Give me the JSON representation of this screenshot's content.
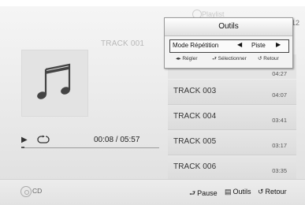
{
  "header": {
    "playlist_label": "Playlist",
    "track_count": "12"
  },
  "now_playing": {
    "track_title": "TRACK 001",
    "time": "00:08 / 05:57",
    "progress": 0.022
  },
  "tracks": [
    {
      "name": "TRACK 003",
      "duration": "04:07"
    },
    {
      "name": "TRACK 004",
      "duration": "03:41"
    },
    {
      "name": "TRACK 005",
      "duration": "03:17"
    },
    {
      "name": "TRACK 006",
      "duration": "03:35"
    }
  ],
  "hidden_track": {
    "duration": "04:27"
  },
  "tools_popup": {
    "title": "Outils",
    "option_label": "Mode Répétition",
    "option_value": "Piste",
    "help_adjust": "Régler",
    "help_select": "Sélectionner",
    "help_back": "Retour"
  },
  "footer": {
    "source": "CD",
    "pause": "Pause",
    "tools": "Outils",
    "back": "Retour"
  },
  "icons": {
    "play": "play-icon",
    "repeat": "repeat-icon",
    "music_note": "music-note-icon",
    "disc": "disc-icon"
  }
}
